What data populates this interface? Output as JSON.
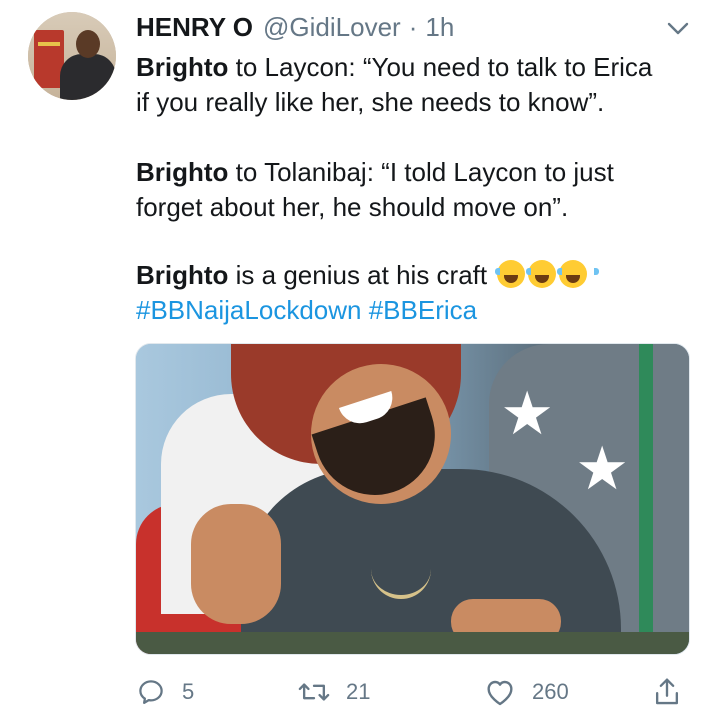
{
  "tweet": {
    "author_name": "HENRY O",
    "author_handle": "@GidiLover",
    "separator": "·",
    "time": "1h",
    "lines": {
      "l1_bold": "Brighto",
      "l1_rest": " to Laycon: “You need to talk to Erica",
      "l2": "if you really like her, she needs to know”.",
      "l3_bold": "Brighto",
      "l3_rest": " to Tolanibaj: “I told Laycon to just",
      "l4": "forget about her, he should move on”.",
      "l5_bold": "Brighto",
      "l5_rest": " is a genius at his craft ",
      "hashtag1": "#BBNaijaLockdown",
      "hashtag2": "#BBErica"
    },
    "emojis": [
      "face-with-tears-of-joy",
      "face-with-tears-of-joy",
      "face-with-tears-of-joy"
    ]
  },
  "actions": {
    "reply_count": "5",
    "retweet_count": "21",
    "like_count": "260"
  },
  "icons": {
    "menu": "chevron-down-icon",
    "reply": "reply-icon",
    "retweet": "retweet-icon",
    "like": "heart-icon",
    "share": "share-icon"
  },
  "colors": {
    "text": "#14171a",
    "secondary": "#657786",
    "link": "#1b95e0"
  }
}
